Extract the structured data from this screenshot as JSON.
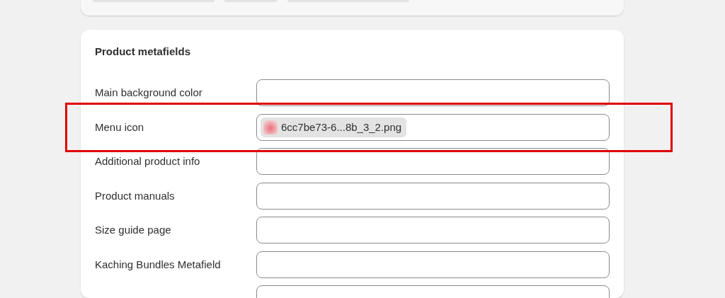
{
  "card": {
    "title": "Product metafields",
    "rows": [
      {
        "label": "Main background color",
        "kind": "text"
      },
      {
        "label": "Menu icon",
        "kind": "file",
        "file_name": "6cc7be73-6...8b_3_2.png"
      },
      {
        "label": "Additional product info",
        "kind": "text"
      },
      {
        "label": "Product manuals",
        "kind": "text"
      },
      {
        "label": "Size guide page",
        "kind": "text"
      },
      {
        "label": "Kaching Bundles Metafield",
        "kind": "text"
      },
      {
        "kind": "text"
      }
    ]
  }
}
